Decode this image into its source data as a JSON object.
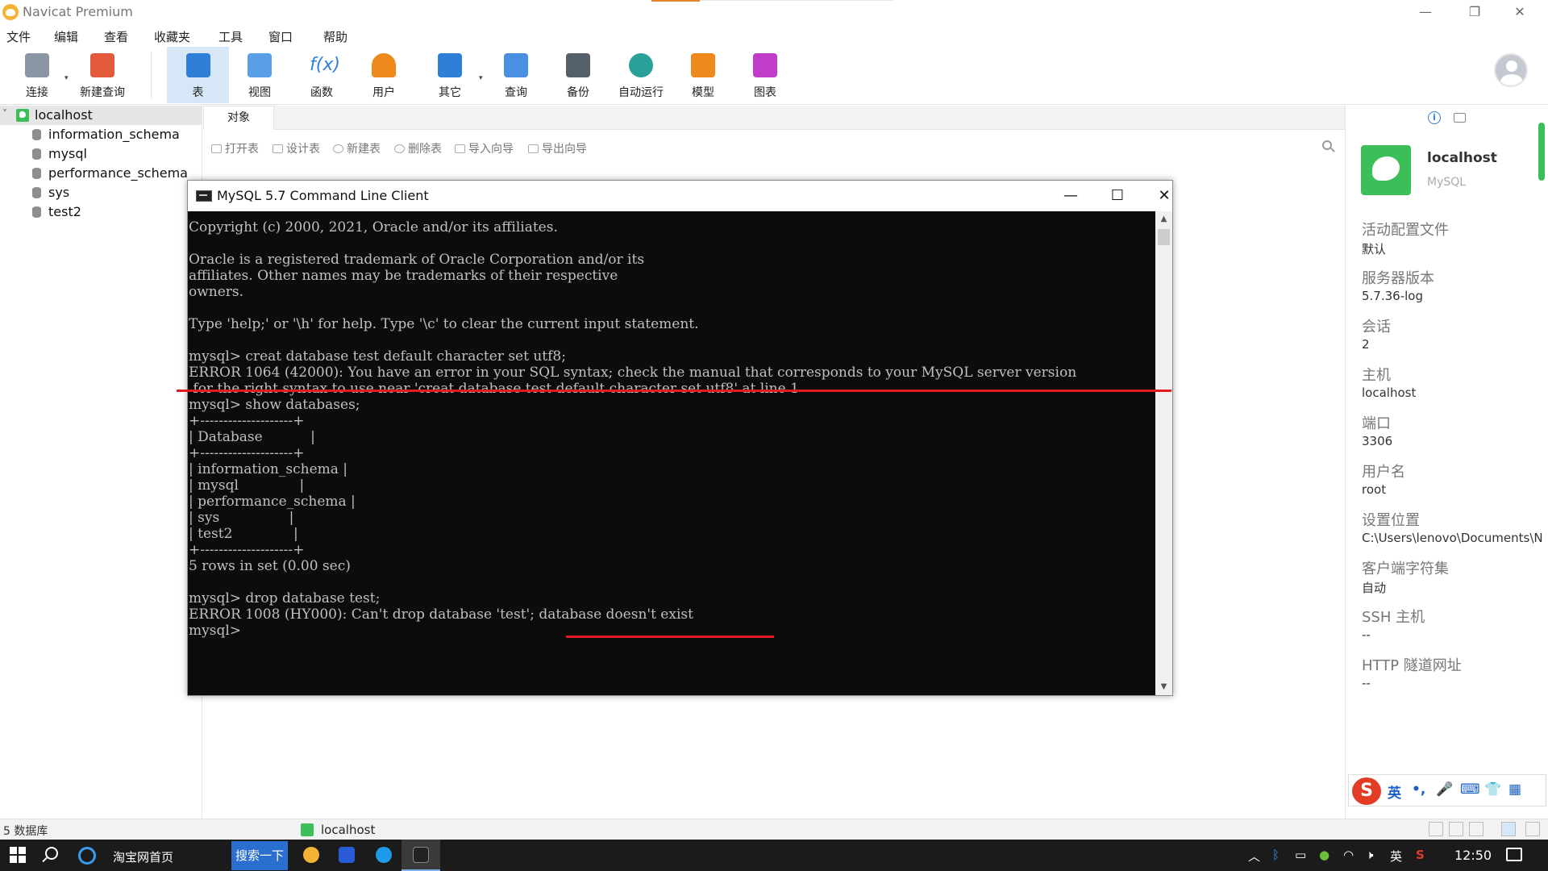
{
  "app": {
    "title": "Navicat Premium",
    "window_controls": {
      "minimize": "—",
      "restore": "❐",
      "close": "✕"
    }
  },
  "menu": [
    "文件",
    "编辑",
    "查看",
    "收藏夹",
    "工具",
    "窗口",
    "帮助"
  ],
  "toolbar": {
    "items": [
      {
        "label": "连接",
        "icon": "plug-icon",
        "color": "#6c7a89"
      },
      {
        "label": "新建查询",
        "icon": "new-query-icon",
        "color": "#e25a3b"
      },
      {
        "label": "表",
        "icon": "table-icon",
        "color": "#2f7fd8",
        "active": true
      },
      {
        "label": "视图",
        "icon": "view-icon",
        "color": "#2f7fd8"
      },
      {
        "label": "函数",
        "icon": "function-icon",
        "color": "#2f7fd8"
      },
      {
        "label": "用户",
        "icon": "user-icon",
        "color": "#f0891b"
      },
      {
        "label": "其它",
        "icon": "tools-icon",
        "color": "#2f7fd8"
      },
      {
        "label": "查询",
        "icon": "query-icon",
        "color": "#2f7fd8"
      },
      {
        "label": "备份",
        "icon": "backup-icon",
        "color": "#55606b"
      },
      {
        "label": "自动运行",
        "icon": "robot-icon",
        "color": "#2aa198"
      },
      {
        "label": "模型",
        "icon": "model-icon",
        "color": "#f0891b"
      },
      {
        "label": "图表",
        "icon": "chart-icon",
        "color": "#c03dc9"
      }
    ]
  },
  "tree": {
    "root": "localhost",
    "databases": [
      "information_schema",
      "mysql",
      "performance_schema",
      "sys",
      "test2"
    ]
  },
  "objects": {
    "tab": "对象",
    "actions": [
      "打开表",
      "设计表",
      "新建表",
      "删除表",
      "导入向导",
      "导出向导"
    ]
  },
  "cmd": {
    "title": "MySQL 5.7 Command Line Client",
    "controls": {
      "minimize": "—",
      "maximize": "☐",
      "close": "✕"
    },
    "lines": [
      "Copyright (c) 2000, 2021, Oracle and/or its affiliates.",
      "",
      "Oracle is a registered trademark of Oracle Corporation and/or its",
      "affiliates. Other names may be trademarks of their respective",
      "owners.",
      "",
      "Type 'help;' or '\\h' for help. Type '\\c' to clear the current input statement.",
      "",
      "mysql> creat database test default character set utf8;",
      "ERROR 1064 (42000): You have an error in your SQL syntax; check the manual that corresponds to your MySQL server version",
      " for the right syntax to use near 'creat database test default character set utf8' at line 1",
      "mysql> show databases;",
      "+--------------------+",
      "| Database           |",
      "+--------------------+",
      "| information_schema |",
      "| mysql              |",
      "| performance_schema |",
      "| sys                |",
      "| test2              |",
      "+--------------------+",
      "5 rows in set (0.00 sec)",
      "",
      "mysql> drop database test;",
      "ERROR 1008 (HY000): Can't drop database 'test'; database doesn't exist",
      "mysql>"
    ]
  },
  "info": {
    "name": "localhost",
    "type": "MySQL",
    "fields": [
      {
        "key": "活动配置文件",
        "value": "默认"
      },
      {
        "key": "服务器版本",
        "value": "5.7.36-log"
      },
      {
        "key": "会话",
        "value": "2"
      },
      {
        "key": "主机",
        "value": "localhost"
      },
      {
        "key": "端口",
        "value": "3306"
      },
      {
        "key": "用户名",
        "value": "root"
      },
      {
        "key": "设置位置",
        "value": "C:\\Users\\lenovo\\Documents\\N"
      },
      {
        "key": "客户端字符集",
        "value": "自动"
      },
      {
        "key": "SSH 主机",
        "value": "--"
      },
      {
        "key": "HTTP 隧道网址",
        "value": "--"
      }
    ]
  },
  "status": {
    "count": "5 数据库",
    "connection": "localhost"
  },
  "ime": {
    "logo": "S",
    "lang": "英",
    "items": [
      "•,",
      "🎤",
      "⌨",
      "👕",
      "▦"
    ]
  },
  "taskbar": {
    "browser_label": "淘宝网首页",
    "search_button": "搜索一下",
    "ime_lang": "英",
    "time": "12:50"
  }
}
